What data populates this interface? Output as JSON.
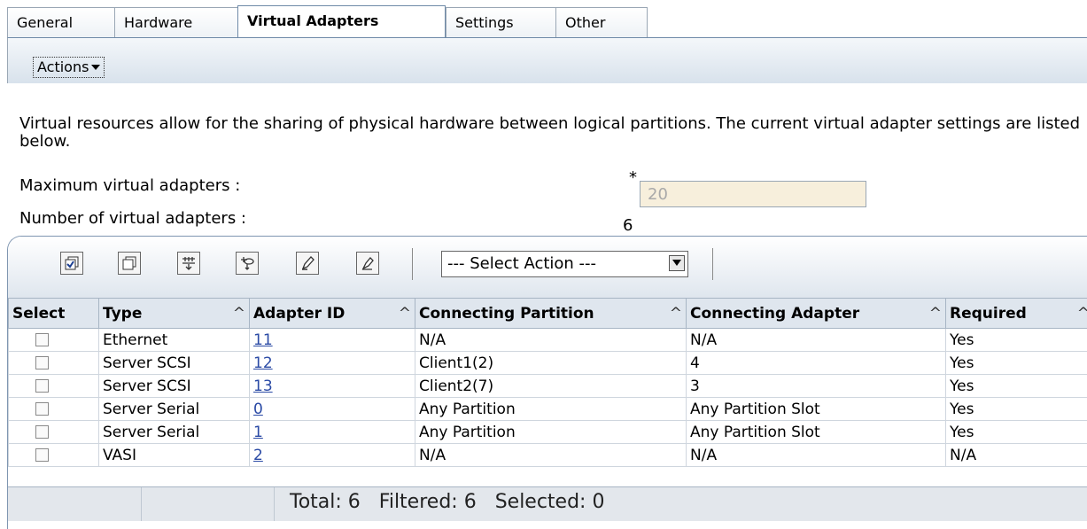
{
  "tabs": [
    {
      "label": "General",
      "active": false
    },
    {
      "label": "Hardware",
      "active": false
    },
    {
      "label": "Virtual Adapters",
      "active": true
    },
    {
      "label": "Settings",
      "active": false
    },
    {
      "label": "Other",
      "active": false
    }
  ],
  "actions": {
    "label": "Actions"
  },
  "description": "Virtual resources allow for the sharing of physical hardware between logical partitions. The current virtual adapter settings are listed below.",
  "form": {
    "max_label": "Maximum virtual adapters :",
    "max_value": "20",
    "required_marker": "*",
    "num_label": "Number of virtual adapters :",
    "num_value": "6"
  },
  "toolbar": {
    "icons": [
      "select-all-icon",
      "deselect-all-icon",
      "show-filter-icon",
      "edit-sort-icon",
      "edit-icon",
      "clear-icon"
    ],
    "select_action": "--- Select Action ---"
  },
  "table": {
    "columns": [
      "Select",
      "Type",
      "Adapter ID",
      "Connecting Partition",
      "Connecting Adapter",
      "Required"
    ],
    "rows": [
      {
        "type": "Ethernet",
        "adapter_id": "11",
        "partition": "N/A",
        "adapter": "N/A",
        "required": "Yes"
      },
      {
        "type": "Server SCSI",
        "adapter_id": "12",
        "partition": "Client1(2)",
        "adapter": "4",
        "required": "Yes"
      },
      {
        "type": "Server SCSI",
        "adapter_id": "13",
        "partition": "Client2(7)",
        "adapter": "3",
        "required": "Yes"
      },
      {
        "type": "Server Serial",
        "adapter_id": "0",
        "partition": "Any Partition",
        "adapter": "Any Partition Slot",
        "required": "Yes"
      },
      {
        "type": "Server Serial",
        "adapter_id": "1",
        "partition": "Any Partition",
        "adapter": "Any Partition Slot",
        "required": "Yes"
      },
      {
        "type": "VASI",
        "adapter_id": "2",
        "partition": "N/A",
        "adapter": "N/A",
        "required": "N/A"
      }
    ]
  },
  "footer": {
    "total_label": "Total:",
    "total": "6",
    "filtered_label": "Filtered:",
    "filtered": "6",
    "selected_label": "Selected:",
    "selected": "0"
  }
}
